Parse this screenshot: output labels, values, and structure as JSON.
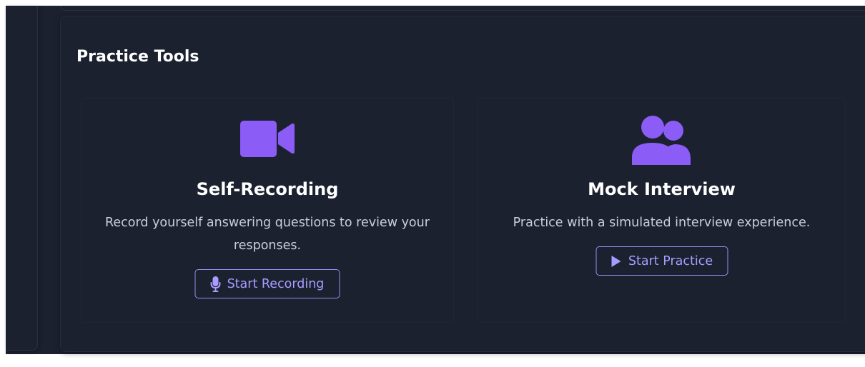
{
  "practice_tools": {
    "title": "Practice Tools",
    "accent_color": "#8b5cf6",
    "button_color": "#a99cff",
    "cards": [
      {
        "icon": "video-camera-icon",
        "title": "Self-Recording",
        "description": "Record yourself answering questions to review your responses.",
        "button_icon": "microphone-icon",
        "button_label": "Start Recording"
      },
      {
        "icon": "users-icon",
        "title": "Mock Interview",
        "description": "Practice with a simulated interview experience.",
        "button_icon": "play-icon",
        "button_label": "Start Practice"
      }
    ]
  }
}
